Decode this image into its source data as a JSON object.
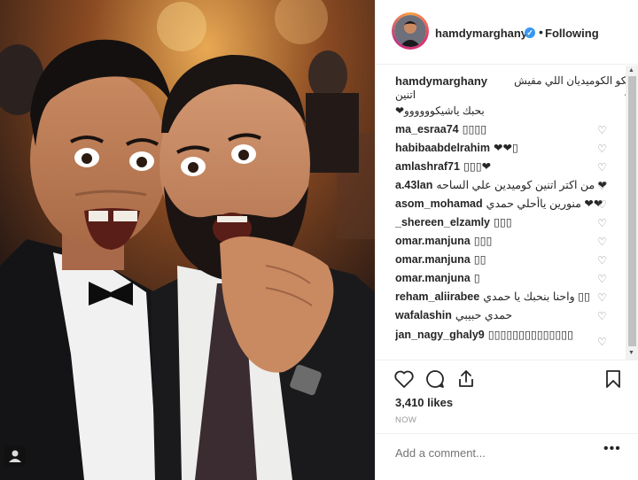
{
  "post": {
    "username": "hamdymarghany",
    "verified_mark": "✓",
    "separator": "•",
    "follow_status": "Following"
  },
  "caption": {
    "username": "hamdymarghany",
    "line1": "شيكو الكوميديان اللي مفيش منه",
    "line2": "اتنين",
    "line3": "بحبك ياشيكوووووو❤"
  },
  "comments": [
    {
      "user": "ma_esraa74",
      "text": "▯▯▯▯"
    },
    {
      "user": "habibaabdelrahim",
      "text": "❤❤▯"
    },
    {
      "user": "amlashraf71",
      "text": "▯▯▯❤"
    },
    {
      "user": "a.43lan",
      "text": "من اكتر اتنين كوميدين علي الساحه ❤"
    },
    {
      "user": "asom_mohamad",
      "text": "منورين ياأحلي حمدي ❤❤"
    },
    {
      "user": "_shereen_elzamly",
      "text": "▯▯▯"
    },
    {
      "user": "omar.manjuna",
      "text": "▯▯▯"
    },
    {
      "user": "omar.manjuna",
      "text": "▯▯"
    },
    {
      "user": "omar.manjuna",
      "text": "▯"
    },
    {
      "user": "reham_aliirabee",
      "text": "واحنا بنحبك يا حمدي ▯▯"
    },
    {
      "user": "wafalashin",
      "text": "حمدي حبيبي"
    },
    {
      "user": "jan_nagy_ghaly9",
      "text": "▯▯▯▯▯▯▯▯▯▯▯▯▯▯"
    }
  ],
  "icons": {
    "heart": "♡",
    "scroll_up": "▲",
    "scroll_down": "▼"
  },
  "likes": "3,410 likes",
  "timestamp": "NOW",
  "add_comment_placeholder": "Add a comment...",
  "more_options": "•••",
  "colors": {
    "verified": "#3897f0",
    "text": "#262626",
    "muted": "#999999"
  }
}
